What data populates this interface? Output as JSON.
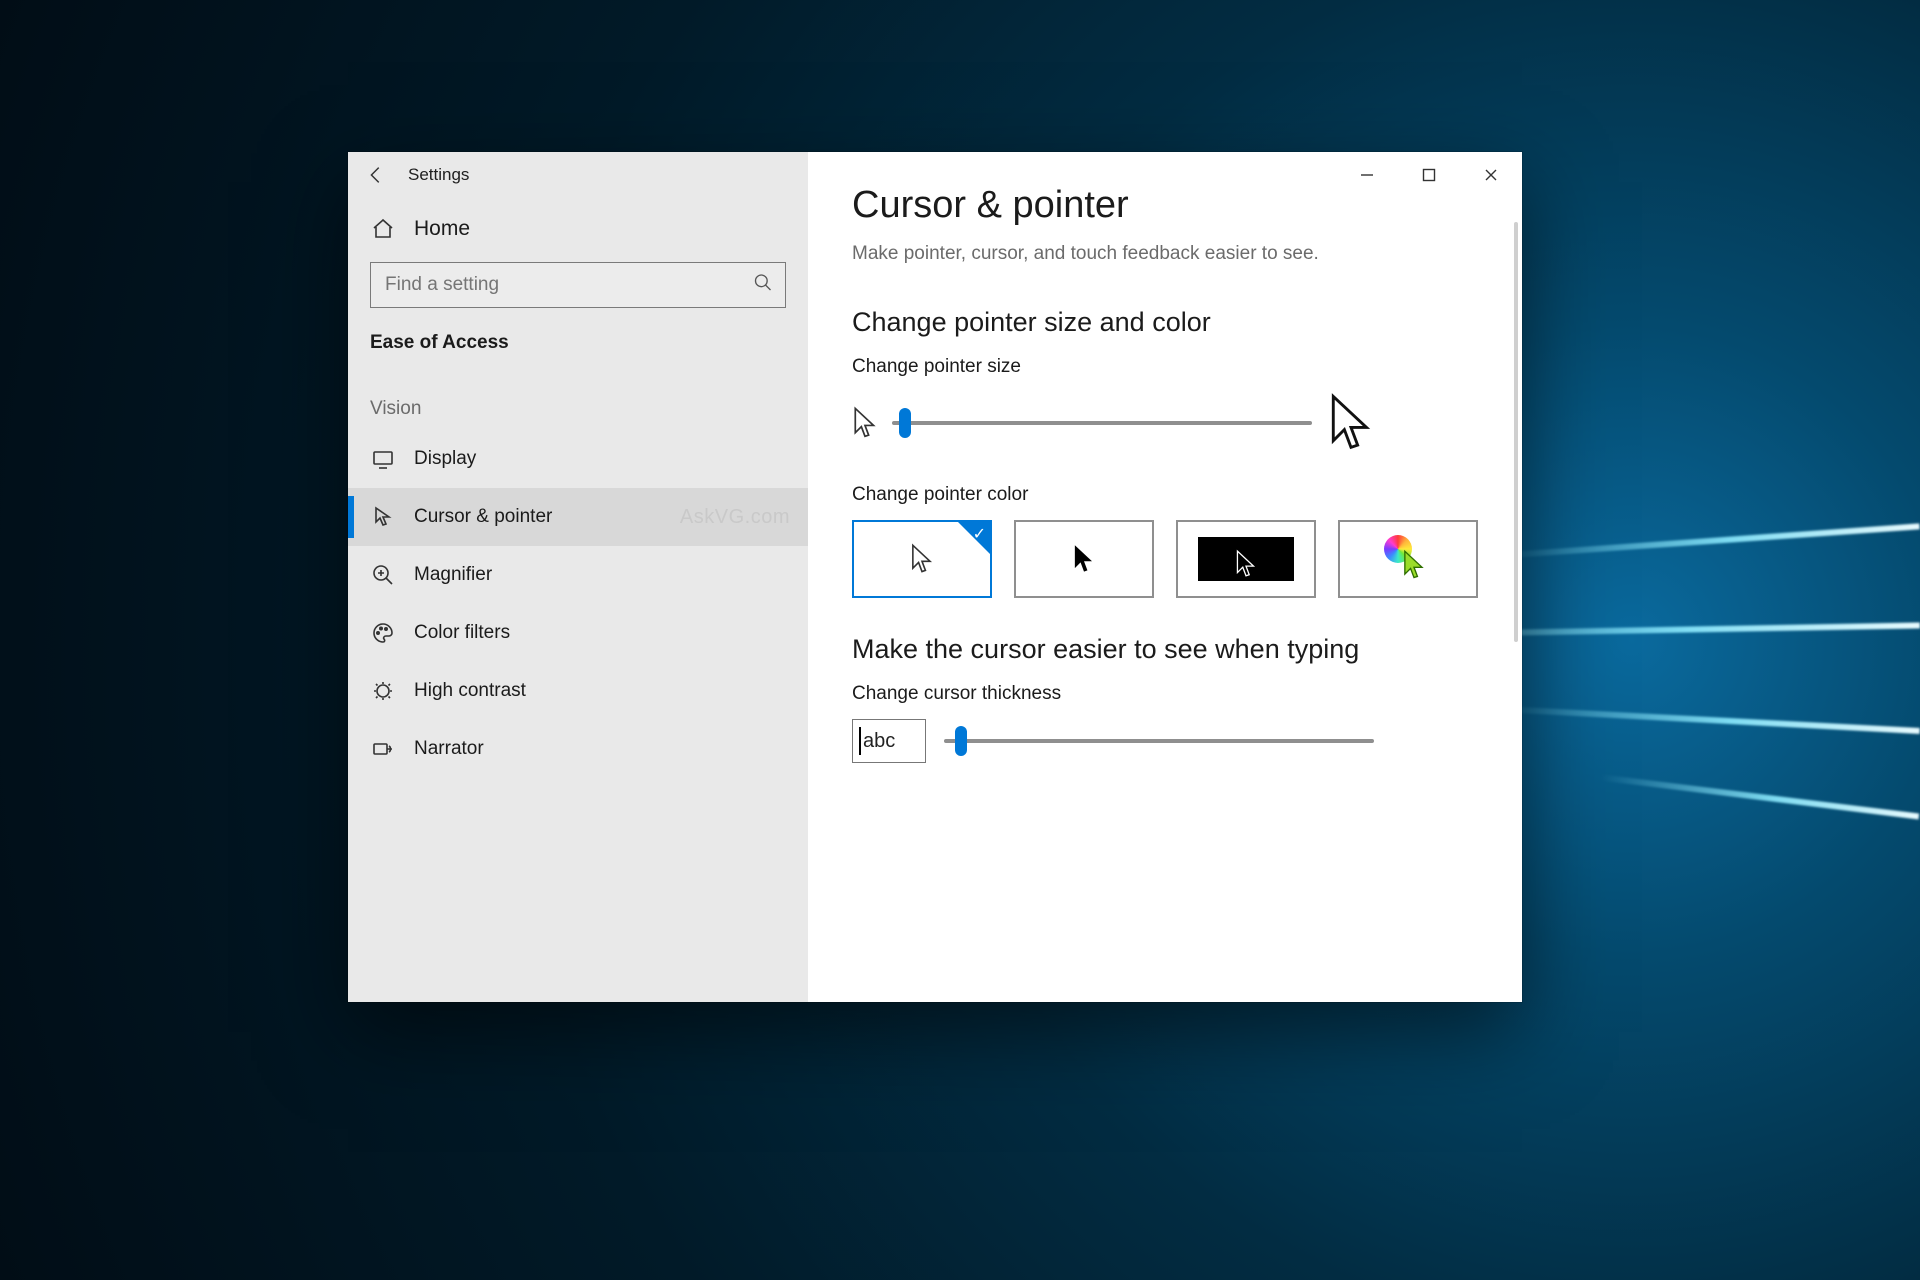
{
  "app_title": "Settings",
  "home_label": "Home",
  "search_placeholder": "Find a setting",
  "section_label": "Ease of Access",
  "group_label": "Vision",
  "watermark": "AskVG.com",
  "nav": [
    {
      "label": "Display"
    },
    {
      "label": "Cursor & pointer",
      "selected": true
    },
    {
      "label": "Magnifier"
    },
    {
      "label": "Color filters"
    },
    {
      "label": "High contrast"
    },
    {
      "label": "Narrator"
    }
  ],
  "page": {
    "title": "Cursor & pointer",
    "subtitle": "Make pointer, cursor, and touch feedback easier to see.",
    "section1": "Change pointer size and color",
    "size_label": "Change pointer size",
    "size_value_percent": 3,
    "color_label": "Change pointer color",
    "color_options": [
      "white",
      "black",
      "inverted",
      "custom"
    ],
    "color_selected_index": 0,
    "section2": "Make the cursor easier to see when typing",
    "thickness_label": "Change cursor thickness",
    "thickness_sample": "abc",
    "thickness_value_percent": 4
  }
}
